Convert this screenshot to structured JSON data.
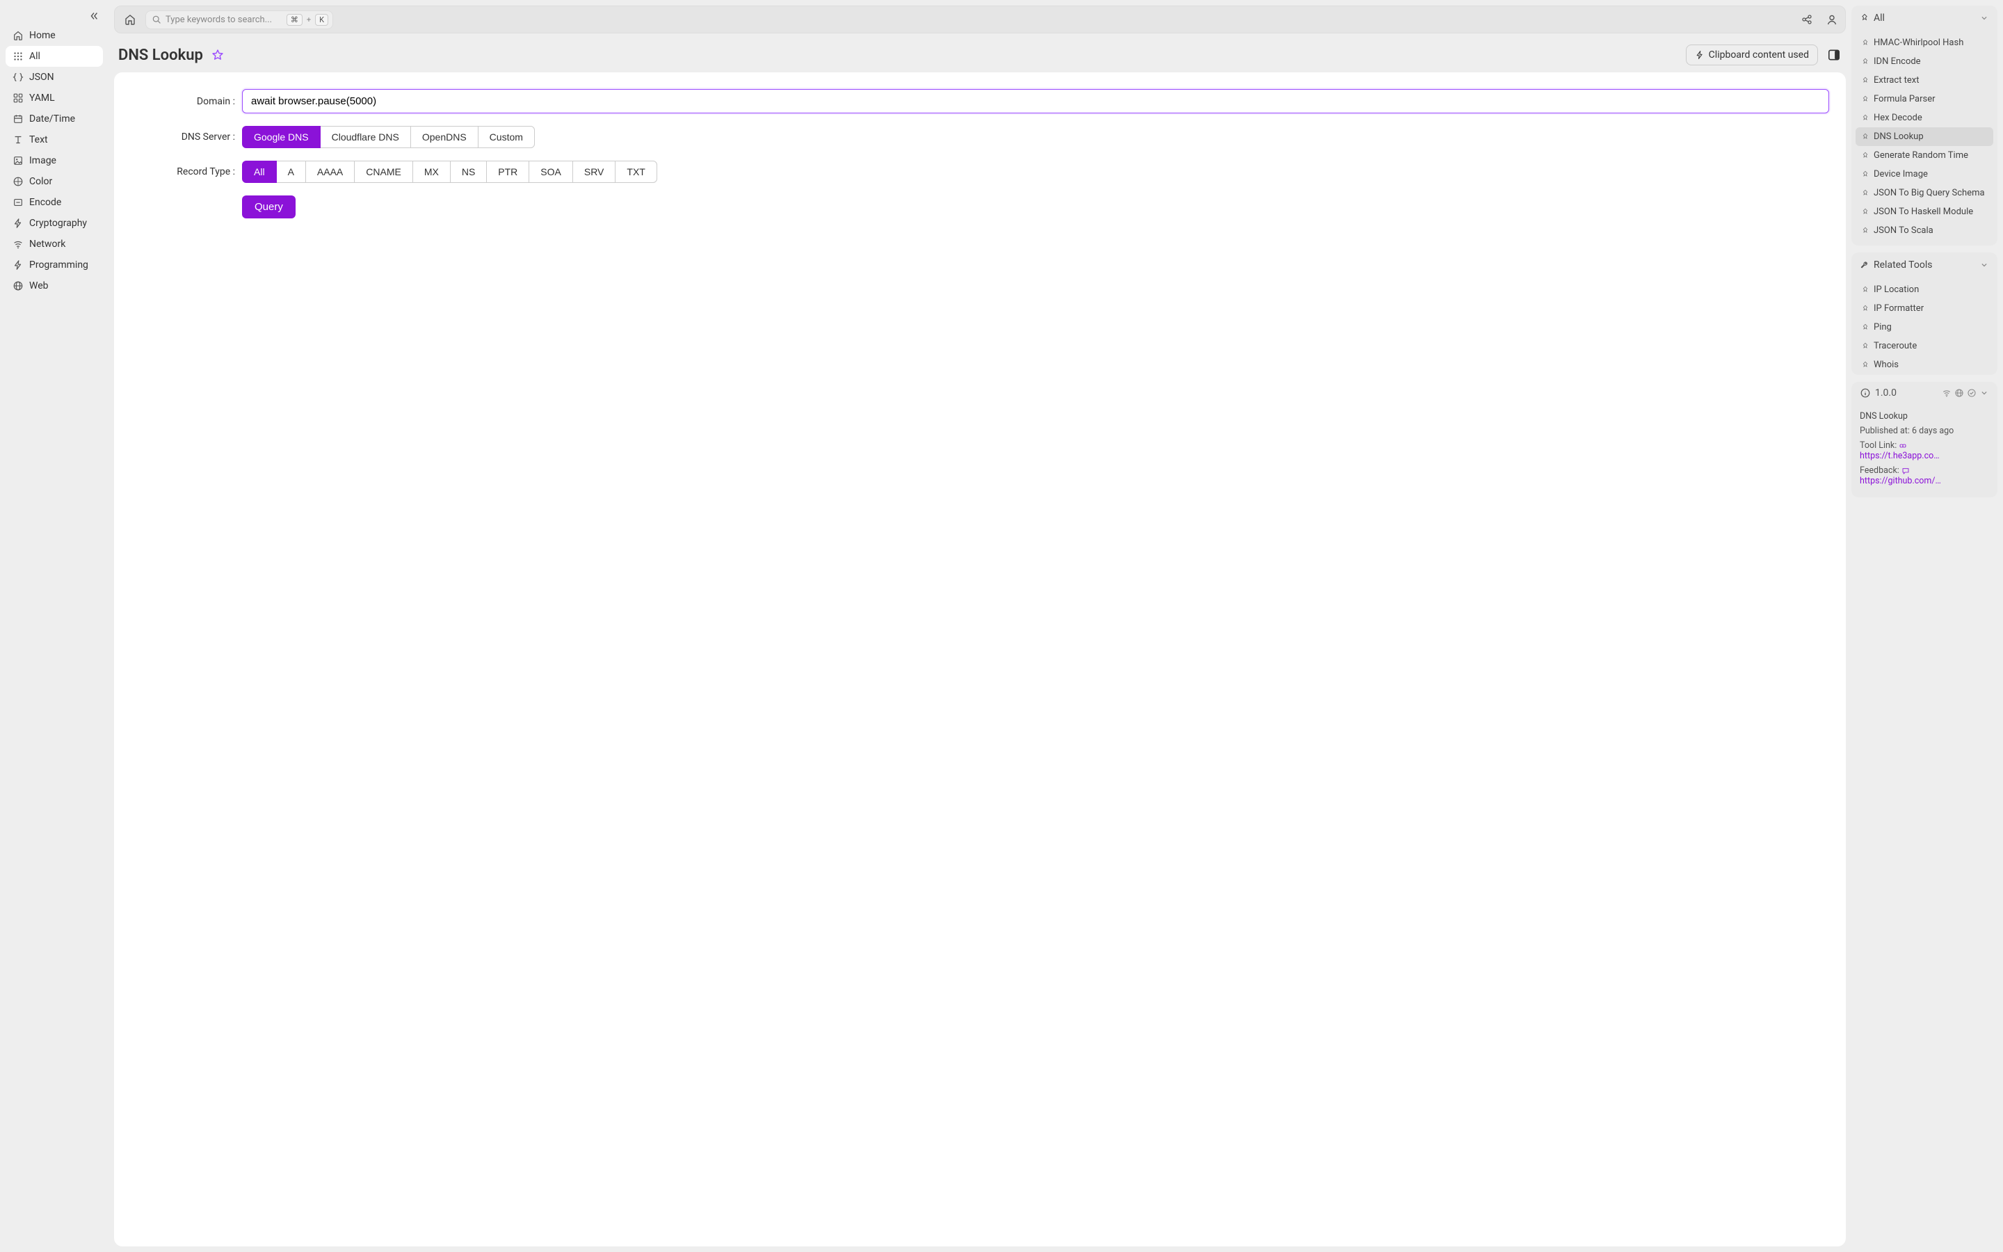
{
  "sidebar": {
    "items": [
      {
        "label": "Home",
        "icon": "home"
      },
      {
        "label": "All",
        "icon": "grid",
        "active": true
      },
      {
        "label": "JSON",
        "icon": "braces"
      },
      {
        "label": "YAML",
        "icon": "grid4"
      },
      {
        "label": "Date/Time",
        "icon": "calendar"
      },
      {
        "label": "Text",
        "icon": "text"
      },
      {
        "label": "Image",
        "icon": "image"
      },
      {
        "label": "Color",
        "icon": "palette"
      },
      {
        "label": "Encode",
        "icon": "encode"
      },
      {
        "label": "Cryptography",
        "icon": "lightning"
      },
      {
        "label": "Network",
        "icon": "wifi"
      },
      {
        "label": "Programming",
        "icon": "lightning"
      },
      {
        "label": "Web",
        "icon": "globe"
      }
    ]
  },
  "topbar": {
    "search_placeholder": "Type keywords to search...",
    "kbd1": "⌘",
    "kbd_plus": "+",
    "kbd2": "K"
  },
  "page": {
    "title": "DNS Lookup",
    "clipboard_label": "Clipboard content used"
  },
  "form": {
    "domain_label": "Domain :",
    "domain_value": "await browser.pause(5000)",
    "dns_server_label": "DNS Server :",
    "dns_servers": [
      "Google DNS",
      "Cloudflare DNS",
      "OpenDNS",
      "Custom"
    ],
    "dns_server_active": 0,
    "record_type_label": "Record Type :",
    "record_types": [
      "All",
      "A",
      "AAAA",
      "CNAME",
      "MX",
      "NS",
      "PTR",
      "SOA",
      "SRV",
      "TXT"
    ],
    "record_type_active": 0,
    "query_label": "Query"
  },
  "right": {
    "all_header": "All",
    "all_items": [
      "HMAC-Whirlpool Hash",
      "IDN Encode",
      "Extract text",
      "Formula Parser",
      "Hex Decode",
      "DNS Lookup",
      "Generate Random Time",
      "Device Image",
      "JSON To Big Query Schema",
      "JSON To Haskell Module",
      "JSON To Scala"
    ],
    "all_active": 5,
    "related_header": "Related Tools",
    "related_items": [
      "IP Location",
      "IP Formatter",
      "Ping",
      "Traceroute",
      "Whois"
    ],
    "info": {
      "version": "1.0.0",
      "title": "DNS Lookup",
      "published_label": "Published at:",
      "published_value": "6 days ago",
      "tool_link_label": "Tool Link:",
      "tool_link_value": "https://t.he3app.co…",
      "feedback_label": "Feedback:",
      "feedback_value": "https://github.com/…"
    }
  }
}
